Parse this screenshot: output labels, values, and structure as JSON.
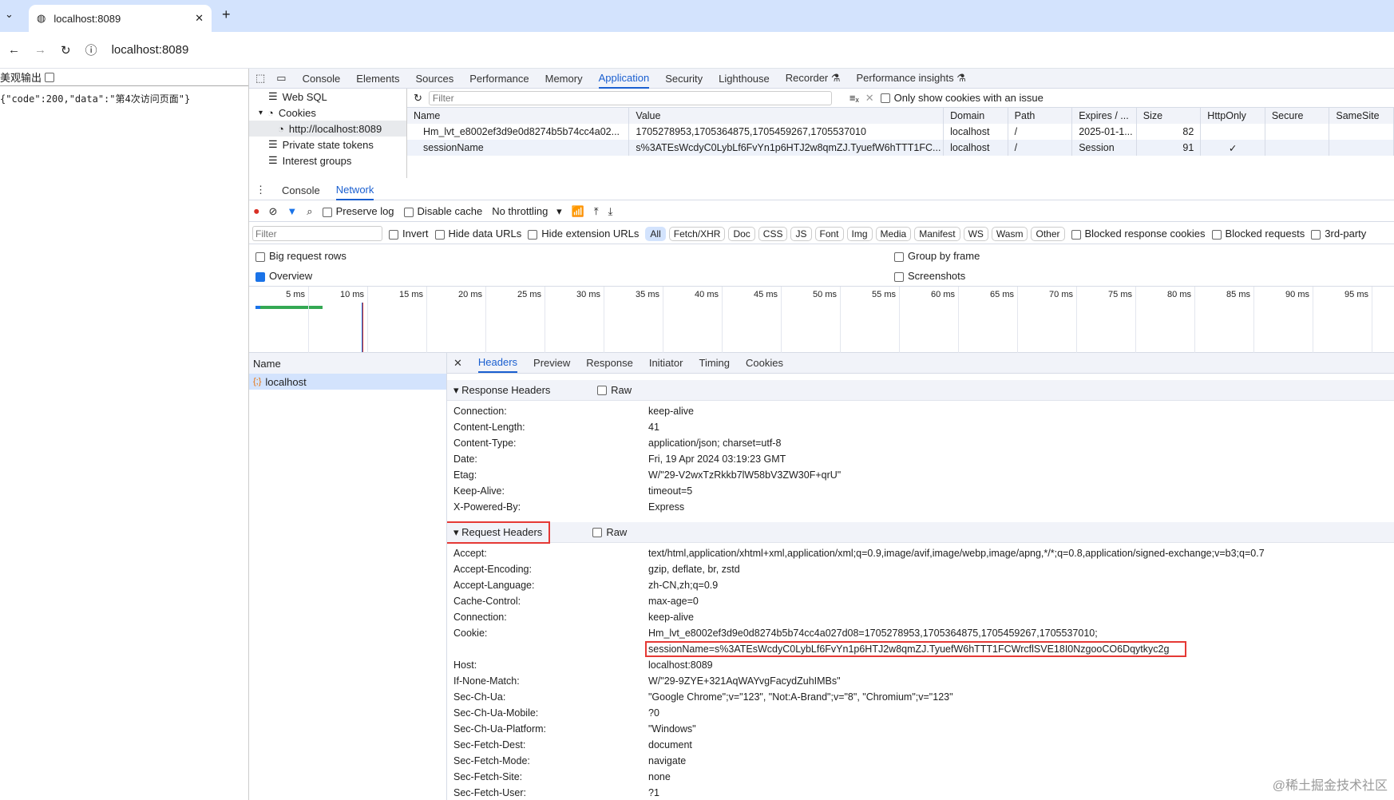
{
  "browser": {
    "tab_title": "localhost:8089",
    "url": "localhost:8089"
  },
  "page": {
    "pretty_label": "美观输出",
    "json_text": "{\"code\":200,\"data\":\"第4次访问页面\"}"
  },
  "devtools": {
    "tabs": [
      "Console",
      "Elements",
      "Sources",
      "Performance",
      "Memory",
      "Application",
      "Security",
      "Lighthouse",
      "Recorder ⚗",
      "Performance insights ⚗"
    ],
    "active_tab": "Application",
    "app_sidebar": [
      "Web SQL",
      "Cookies",
      "http://localhost:8089",
      "Private state tokens",
      "Interest groups"
    ],
    "cookie_filter_placeholder": "Filter",
    "only_issue_label": "Only show cookies with an issue",
    "cookie_columns": [
      "Name",
      "Value",
      "Domain",
      "Path",
      "Expires / ...",
      "Size",
      "HttpOnly",
      "Secure",
      "SameSite"
    ],
    "cookies": [
      [
        "Hm_lvt_e8002ef3d9e0d8274b5b74cc4a02...",
        "1705278953,1705364875,1705459267,1705537010",
        "localhost",
        "/",
        "2025-01-1...",
        "82",
        "",
        "",
        ""
      ],
      [
        "sessionName",
        "s%3ATEsWcdyC0LybLf6FvYn1p6HTJ2w8qmZJ.TyuefW6hTTT1FC...",
        "localhost",
        "/",
        "Session",
        "91",
        "✓",
        "",
        ""
      ]
    ],
    "drawer_tabs": [
      "Console",
      "Network"
    ],
    "network": {
      "preserve_log": "Preserve log",
      "disable_cache": "Disable cache",
      "throttling": "No throttling",
      "filter_placeholder": "Filter",
      "invert": "Invert",
      "hide_data": "Hide data URLs",
      "hide_ext": "Hide extension URLs",
      "types": [
        "All",
        "Fetch/XHR",
        "Doc",
        "CSS",
        "JS",
        "Font",
        "Img",
        "Media",
        "Manifest",
        "WS",
        "Wasm",
        "Other"
      ],
      "blocked_cookies": "Blocked response cookies",
      "blocked_requests": "Blocked requests",
      "third_party": "3rd-party",
      "big_rows": "Big request rows",
      "overview": "Overview",
      "group_frame": "Group by frame",
      "screenshots": "Screenshots",
      "ticks": [
        "5 ms",
        "10 ms",
        "15 ms",
        "20 ms",
        "25 ms",
        "30 ms",
        "35 ms",
        "40 ms",
        "45 ms",
        "50 ms",
        "55 ms",
        "60 ms",
        "65 ms",
        "70 ms",
        "75 ms",
        "80 ms",
        "85 ms",
        "90 ms",
        "95 ms"
      ],
      "name_header": "Name",
      "request": "localhost",
      "detail_tabs": [
        "Headers",
        "Preview",
        "Response",
        "Initiator",
        "Timing",
        "Cookies"
      ],
      "response_title": "Response Headers",
      "request_title": "Request Headers",
      "raw": "Raw",
      "response_headers": [
        [
          "Connection:",
          "keep-alive"
        ],
        [
          "Content-Length:",
          "41"
        ],
        [
          "Content-Type:",
          "application/json; charset=utf-8"
        ],
        [
          "Date:",
          "Fri, 19 Apr 2024 03:19:23 GMT"
        ],
        [
          "Etag:",
          "W/\"29-V2wxTzRkkb7lW58bV3ZW30F+qrU\""
        ],
        [
          "Keep-Alive:",
          "timeout=5"
        ],
        [
          "X-Powered-By:",
          "Express"
        ]
      ],
      "request_headers": [
        [
          "Accept:",
          "text/html,application/xhtml+xml,application/xml;q=0.9,image/avif,image/webp,image/apng,*/*;q=0.8,application/signed-exchange;v=b3;q=0.7"
        ],
        [
          "Accept-Encoding:",
          "gzip, deflate, br, zstd"
        ],
        [
          "Accept-Language:",
          "zh-CN,zh;q=0.9"
        ],
        [
          "Cache-Control:",
          "max-age=0"
        ],
        [
          "Connection:",
          "keep-alive"
        ],
        [
          "Cookie:",
          "Hm_lvt_e8002ef3d9e0d8274b5b74cc4a027d08=1705278953,1705364875,1705459267,1705537010;"
        ],
        [
          "",
          "sessionName=s%3ATEsWcdyC0LybLf6FvYn1p6HTJ2w8qmZJ.TyuefW6hTTT1FCWrcflSVE18I0NzgooCO6Dqytkyc2g"
        ],
        [
          "Host:",
          "localhost:8089"
        ],
        [
          "If-None-Match:",
          "W/\"29-9ZYE+321AqWAYvgFacydZuhIMBs\""
        ],
        [
          "Sec-Ch-Ua:",
          "\"Google Chrome\";v=\"123\", \"Not:A-Brand\";v=\"8\", \"Chromium\";v=\"123\""
        ],
        [
          "Sec-Ch-Ua-Mobile:",
          "?0"
        ],
        [
          "Sec-Ch-Ua-Platform:",
          "\"Windows\""
        ],
        [
          "Sec-Fetch-Dest:",
          "document"
        ],
        [
          "Sec-Fetch-Mode:",
          "navigate"
        ],
        [
          "Sec-Fetch-Site:",
          "none"
        ],
        [
          "Sec-Fetch-User:",
          "?1"
        ]
      ]
    }
  },
  "watermark": "@稀土掘金技术社区",
  "colors": {
    "accent": "#1a5fd0",
    "highlight": "#e53935"
  }
}
